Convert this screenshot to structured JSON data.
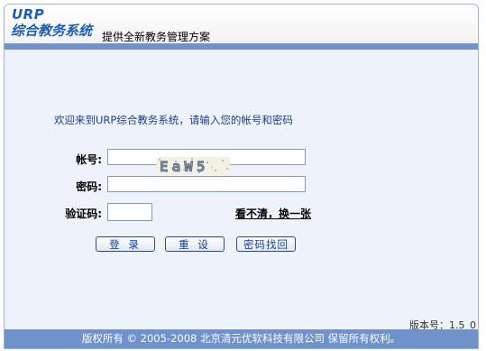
{
  "header": {
    "logo_top": "URP",
    "logo_bottom": "综合教务系统",
    "slogan": "提供全新教务管理方案"
  },
  "login": {
    "welcome": "欢迎来到URP综合教务系统，请输入您的帐号和密码",
    "account_label": "帐号:",
    "password_label": "密码:",
    "captcha_label": "验证码:",
    "account_value": "",
    "password_value": "",
    "captcha_value": "",
    "captcha_text": "EaW5",
    "refresh_captcha": "看不清，换一张",
    "login_button": "登 录",
    "reset_button": "重 设",
    "recover_button": "密码找回"
  },
  "version": "版本号：1.5_0",
  "footer": {
    "copyright": "版权所有 © 2005-2008 北京清元优软科技有限公司  保留所有权利。"
  },
  "colors": {
    "brand_blue": "#1c5fae",
    "band": "#6e92c9",
    "panel_bg": "#eef3fa",
    "welcome_text": "#1a3f8c"
  }
}
